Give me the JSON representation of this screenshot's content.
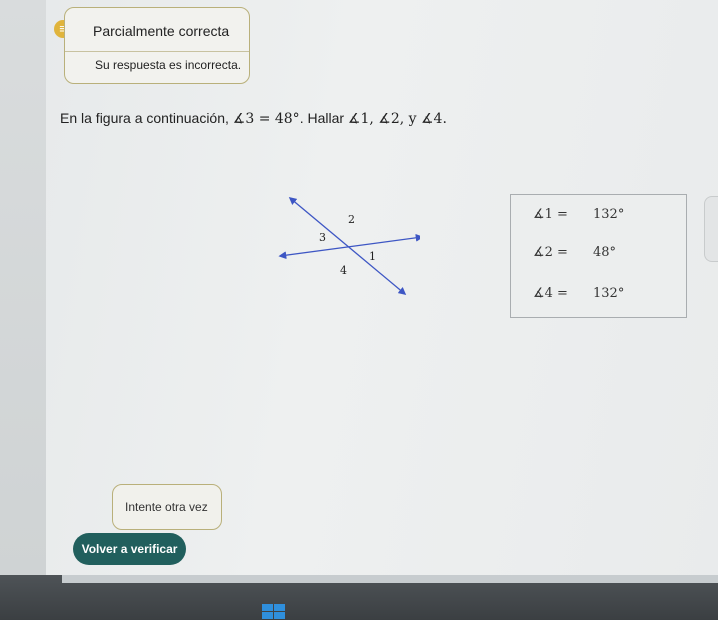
{
  "feedback": {
    "title": "Parcialmente correcta",
    "message": "Su respuesta es incorrecta.",
    "status_color": "#e0b43c"
  },
  "question": {
    "intro": "En la figura a continuación, ",
    "given": "∡3 = 48°",
    "middle": ". Hallar ",
    "targets": "∡1, ∡2, y ∡4."
  },
  "figure": {
    "labels": [
      "2",
      "3",
      "1",
      "4"
    ]
  },
  "answers": [
    {
      "label": "∡1 =",
      "value": "132°"
    },
    {
      "label": "∡2 =",
      "value": "48°"
    },
    {
      "label": "∡4 =",
      "value": "132°"
    }
  ],
  "retry_label": "Intente otra vez",
  "verify_button": "Volver a verificar",
  "accent_color": "#215f5d"
}
